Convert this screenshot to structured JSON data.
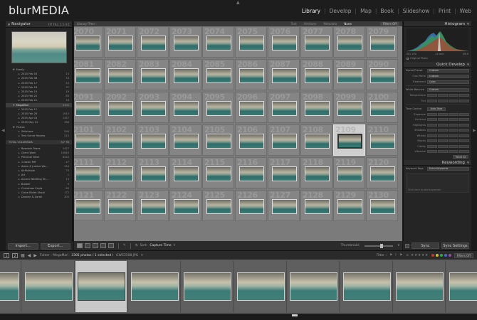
{
  "app": {
    "brand": "blurMEDIA",
    "modules": [
      "Library",
      "Develop",
      "Map",
      "Book",
      "Slideshow",
      "Print",
      "Web"
    ],
    "active_module": "Library"
  },
  "navigator": {
    "title": "Navigator",
    "options": "FIT  FILL  1:1  4:1"
  },
  "folders": {
    "rows_top": [
      {
        "label": "Family",
        "count": "",
        "parent": true
      },
      {
        "label": "2015 Feb 03",
        "count": "13"
      },
      {
        "label": "2015 Feb 08",
        "count": "16"
      },
      {
        "label": "2015 Feb 17",
        "count": "44"
      },
      {
        "label": "2015 Feb 18",
        "count": "37"
      },
      {
        "label": "2015 Feb 19",
        "count": "19"
      },
      {
        "label": "2015 Feb 20",
        "count": "83"
      },
      {
        "label": "2015 Feb 21",
        "count": "18"
      },
      {
        "label": "MegaMari",
        "count": "3305",
        "parent": true,
        "selected": true
      },
      {
        "label": "2015 Feb 11",
        "count": ""
      },
      {
        "label": "2015 Feb 26",
        "count": "1615"
      },
      {
        "label": "2015 Apr 03",
        "count": "1357"
      },
      {
        "label": "2015 May 12",
        "count": "336"
      },
      {
        "label": "Photos",
        "count": "",
        "parent": true
      },
      {
        "label": "Skitshare",
        "count": "590"
      },
      {
        "label": "Tent Genre Review",
        "count": "215"
      }
    ],
    "volume": {
      "label": "TOTAL VOLUMEDIA",
      "count": "5/7 TB"
    },
    "rows_bottom": [
      {
        "label": "Bowdoin Poses",
        "count": "1427"
      },
      {
        "label": "Client Work",
        "count": "10640"
      },
      {
        "label": "Personal Work",
        "count": "6244"
      },
      {
        "label": "1 Down Riff",
        "count": "47"
      },
      {
        "label": "Adam & Justine We...",
        "count": "244"
      },
      {
        "label": "AirMultiple",
        "count": "70"
      },
      {
        "label": "Art",
        "count": "1"
      },
      {
        "label": "Aurora Wedding Sh...",
        "count": "14"
      },
      {
        "label": "Bubble",
        "count": "9"
      },
      {
        "label": "Christmas Cards",
        "count": "80"
      },
      {
        "label": "Clane Ballet Shoot",
        "count": "172"
      },
      {
        "label": "Damian & Sarah",
        "count": "300"
      }
    ],
    "import_label": "Import...",
    "export_label": "Export..."
  },
  "library_filter": {
    "title": "Library Filter :",
    "tabs": [
      "Text",
      "Attribute",
      "Metadata",
      "None"
    ],
    "active_tab": "None",
    "preset": "Filters Off"
  },
  "grid": {
    "numbers": [
      [
        "2070",
        "2071",
        "2072",
        "2073",
        "2074",
        "2075",
        "2076",
        "2077",
        "2078",
        "2079"
      ],
      [
        "2081",
        "2082",
        "2083",
        "2084",
        "2085",
        "2086",
        "2087",
        "2088",
        "2089",
        "2090"
      ],
      [
        "2091",
        "2092",
        "2093",
        "2094",
        "2095",
        "2096",
        "2097",
        "2098",
        "2099",
        "2100"
      ],
      [
        "2101",
        "2102",
        "2103",
        "2104",
        "2105",
        "2106",
        "2107",
        "2108",
        "2109",
        "2110"
      ],
      [
        "2111",
        "2112",
        "2113",
        "2114",
        "2115",
        "2116",
        "2117",
        "2118",
        "2119",
        "2120"
      ],
      [
        "2121",
        "2122",
        "2123",
        "2124",
        "2125",
        "2126",
        "2127",
        "2128",
        "2129",
        "2130"
      ]
    ],
    "selected": {
      "row": 3,
      "col": 8
    }
  },
  "toolbar": {
    "sort_label": "Sort:",
    "sort_value": "Capture Time",
    "thumbnails_label": "Thumbnails"
  },
  "histogram": {
    "title": "Histogram",
    "info_left": "ISO 100",
    "info_mid": "24 mm",
    "info_right": "f/8.0",
    "original_photo": "Original Photo"
  },
  "quick_develop": {
    "title": "Quick Develop",
    "saved_preset_label": "Saved Preset",
    "saved_preset_value": "Custom",
    "crop_ratio_label": "Crop Ratio",
    "crop_ratio_value": "Custom",
    "treatment_label": "Treatment",
    "treatment_value": "Color",
    "white_balance_label": "White Balance",
    "white_balance_value": "Custom",
    "temperature_label": "Temperature",
    "tint_label": "Tint",
    "tone_control_label": "Tone Control",
    "auto_tone": "Auto Tone",
    "exposure_label": "Exposure",
    "contrast_label": "Contrast",
    "highlights_label": "Highlights",
    "shadows_label": "Shadows",
    "whites_label": "Whites",
    "blacks_label": "Blacks",
    "clarity_label": "Clarity",
    "vibrance_label": "Vibrance",
    "reset_all": "Reset All"
  },
  "keywording": {
    "title": "Keywording",
    "tags_label": "Keyword Tags",
    "tags_value": "Enter Keywords",
    "hint": "Click here to add keywords"
  },
  "sync": {
    "sync_label": "Sync",
    "sync_settings_label": "Sync Settings"
  },
  "filmbar": {
    "folder_text": "Folder : MegaMari",
    "count_text": "3305 photos / 1 selected /",
    "file_text": "GWS3508.JPG",
    "filter_label": "Filter :",
    "filter_value": "Filters Off",
    "page_one": "1",
    "page_two": "2"
  },
  "filmstrip": {
    "count": 9,
    "selected_index": 1
  },
  "colors": {
    "accent": "#e6e6e6",
    "label_red": "#c0392b",
    "label_yellow": "#d4c13a",
    "label_green": "#3aa04a",
    "label_blue": "#3f6fc8",
    "label_purple": "#8f4fb3"
  }
}
